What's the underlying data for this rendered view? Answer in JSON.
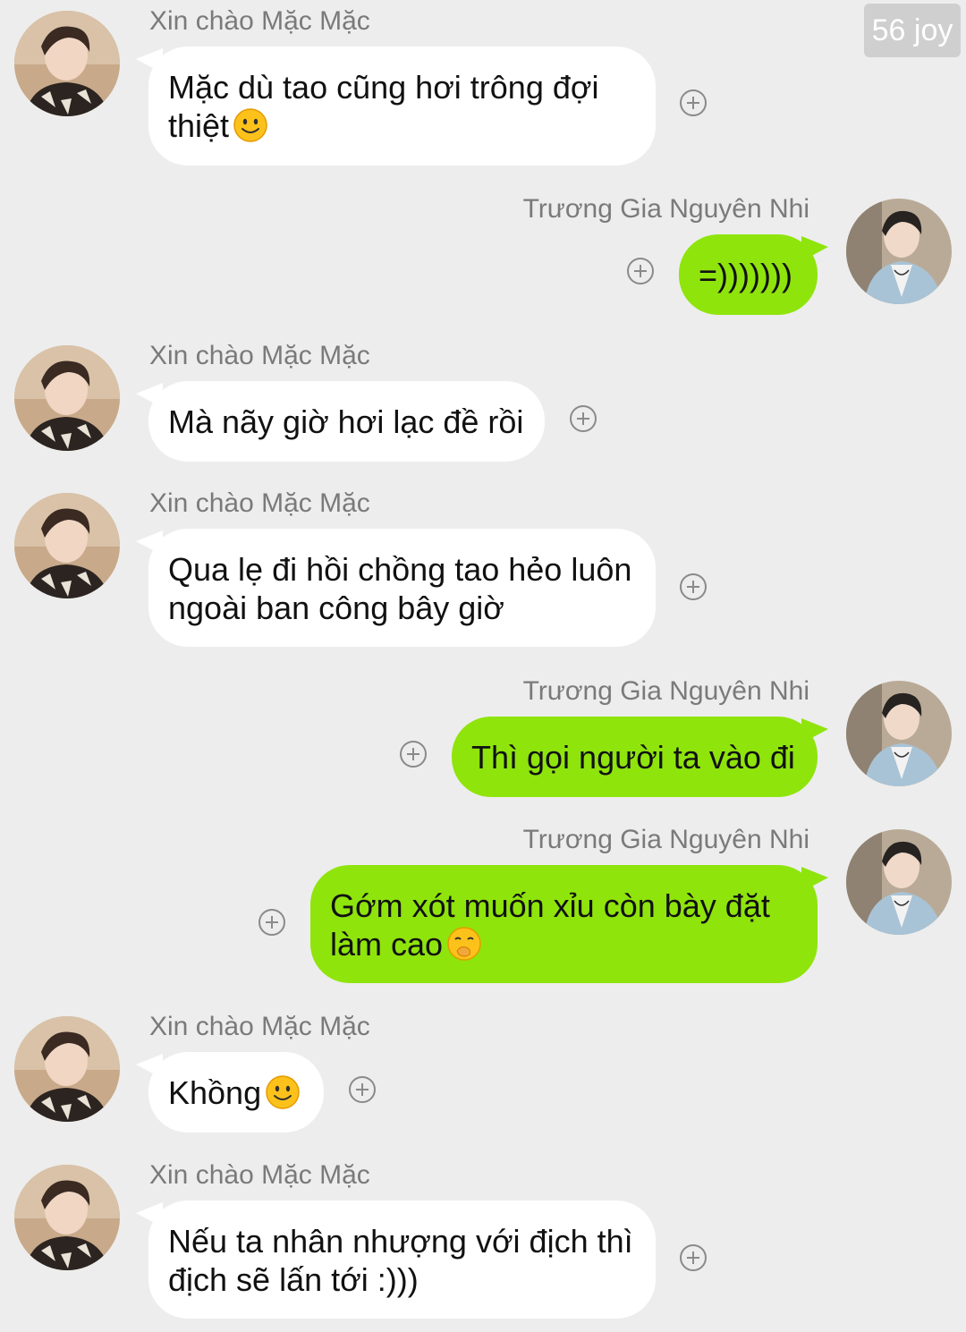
{
  "watermark": "56 joy",
  "contacts": {
    "other": "Xin chào Mặc Mặc",
    "me": "Trương Gia Nguyên Nhi"
  },
  "colors": {
    "background": "#ededed",
    "incoming_bubble": "#ffffff",
    "outgoing_bubble": "#8fe40c",
    "sender_name": "#7a7a7a"
  },
  "messages": [
    {
      "sender": "Xin chào Mặc Mặc",
      "direction": "incoming",
      "line1": "Mặc dù tao cũng hơi trông đợi",
      "line2": "thiệt",
      "emoji": "slightly-smiling-face"
    },
    {
      "sender": "Trương Gia Nguyên Nhi",
      "direction": "outgoing",
      "line1": "=)))))))"
    },
    {
      "sender": "Xin chào Mặc Mặc",
      "direction": "incoming",
      "line1": "Mà nãy giờ hơi lạc đề rồi"
    },
    {
      "sender": "Xin chào Mặc Mặc",
      "direction": "incoming",
      "line1": "Qua lẹ đi hồi chồng tao hẻo luôn",
      "line2": "ngoài ban công bây giờ"
    },
    {
      "sender": "Trương Gia Nguyên Nhi",
      "direction": "outgoing",
      "line1": "Thì gọi người ta vào đi"
    },
    {
      "sender": "Trương Gia Nguyên Nhi",
      "direction": "outgoing",
      "line1": "Gớm xót muốn xỉu còn bày đặt",
      "line2": "làm cao",
      "emoji": "face-with-hand-over-mouth"
    },
    {
      "sender": "Xin chào Mặc Mặc",
      "direction": "incoming",
      "line1": "Khồng",
      "emoji": "slightly-smiling-face"
    },
    {
      "sender": "Xin chào Mặc Mặc",
      "direction": "incoming",
      "line1": "Nếu ta nhân nhượng với địch thì",
      "line2": "địch sẽ lấn tới :)))"
    }
  ]
}
